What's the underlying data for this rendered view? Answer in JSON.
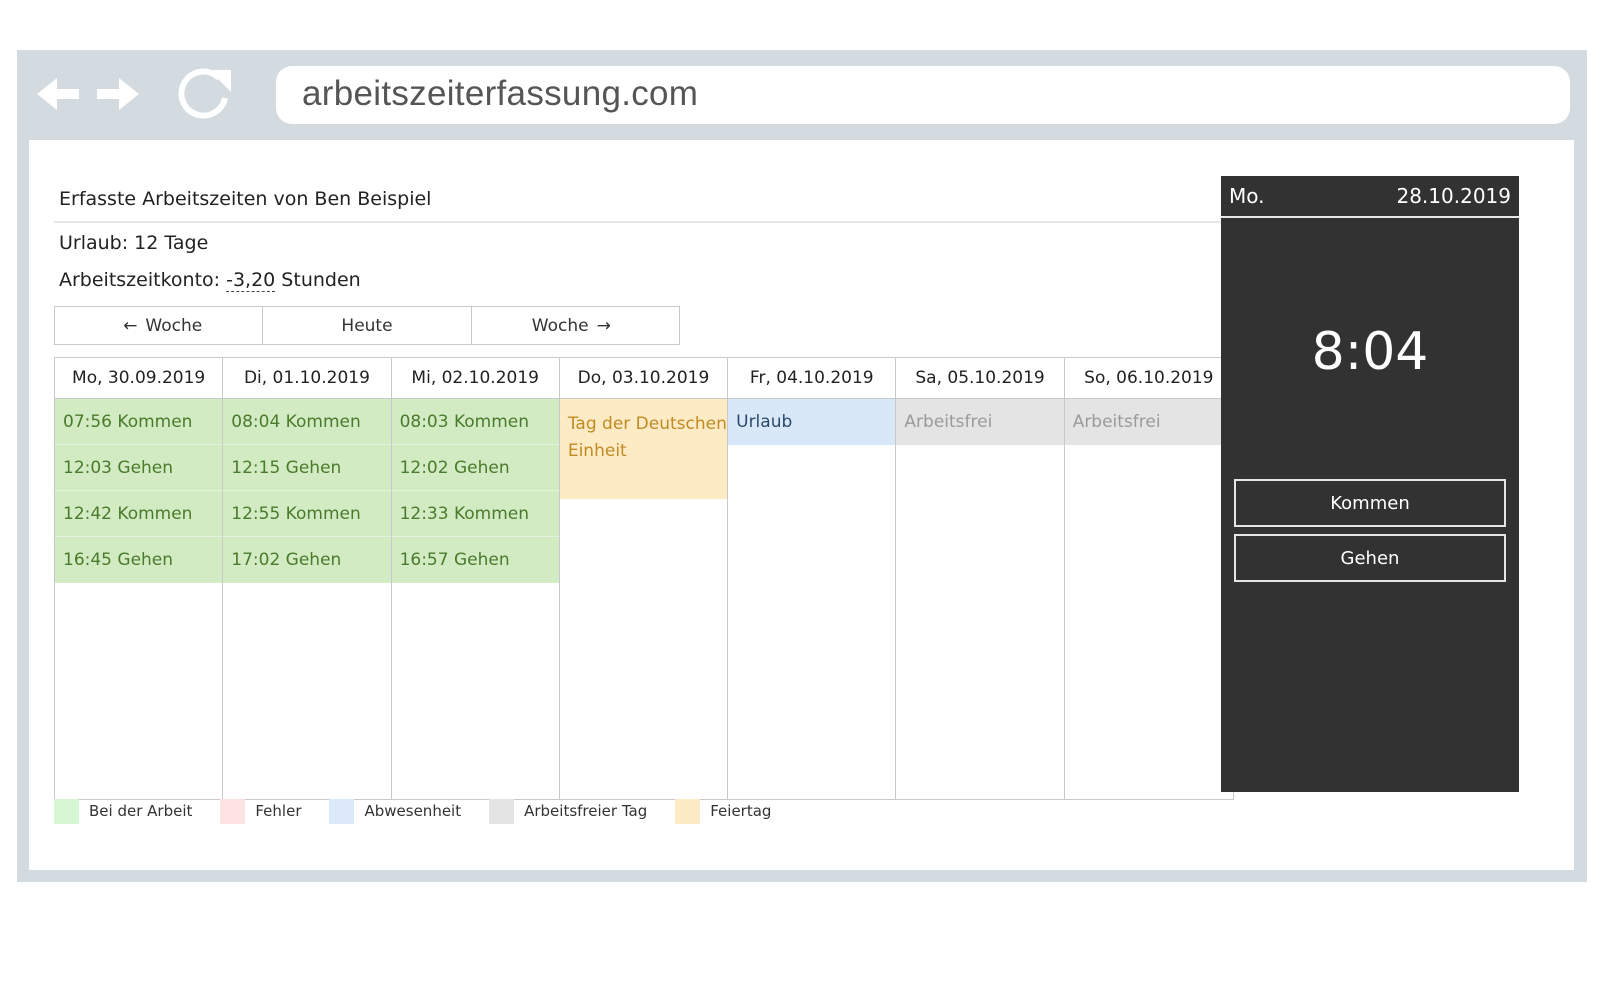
{
  "browser": {
    "url": "arbeitszeiterfassung.com",
    "icons": {
      "back": "arrow-left-icon",
      "forward": "arrow-right-icon",
      "reload": "reload-icon"
    },
    "frame_color": "#d3dae0"
  },
  "page": {
    "title": "Erfasste Arbeitszeiten von Ben Beispiel",
    "urlaub_label": "Urlaub: 12 Tage",
    "konto_label": "Arbeitszeitkonto: ",
    "konto_value": "-3,20",
    "konto_unit": " Stunden"
  },
  "week_nav": {
    "prev_label": "Woche",
    "today_label": "Heute",
    "next_label": "Woche"
  },
  "calendar": {
    "days": [
      {
        "header": "Mo, 30.09.2019",
        "entries": [
          "07:56 Kommen",
          "12:03 Gehen",
          "12:42 Kommen",
          "16:45 Gehen"
        ]
      },
      {
        "header": "Di, 01.10.2019",
        "entries": [
          "08:04 Kommen",
          "12:15 Gehen",
          "12:55 Kommen",
          "17:02 Gehen"
        ]
      },
      {
        "header": "Mi, 02.10.2019",
        "entries": [
          "08:03 Kommen",
          "12:02 Gehen",
          "12:33 Kommen",
          "16:57 Gehen"
        ]
      },
      {
        "header": "Do, 03.10.2019",
        "holiday": "Tag der Deutschen Einheit"
      },
      {
        "header": "Fr, 04.10.2019",
        "absence": "Urlaub"
      },
      {
        "header": "Sa, 05.10.2019",
        "free": "Arbeitsfrei"
      },
      {
        "header": "So, 06.10.2019",
        "free": "Arbeitsfrei"
      }
    ]
  },
  "legend": [
    {
      "label": "Bei der Arbeit",
      "color": "#d5f5d3"
    },
    {
      "label": "Fehler",
      "color": "#fde3e1"
    },
    {
      "label": "Abwesenheit",
      "color": "#dbe9fb"
    },
    {
      "label": "Arbeitsfreier Tag",
      "color": "#e4e4e4"
    },
    {
      "label": "Feiertag",
      "color": "#fdebc6"
    }
  ],
  "clock": {
    "weekday": "Mo.",
    "date": "28.10.2019",
    "time": "8:04",
    "kommen_label": "Kommen",
    "gehen_label": "Gehen",
    "panel_color": "#323232"
  }
}
